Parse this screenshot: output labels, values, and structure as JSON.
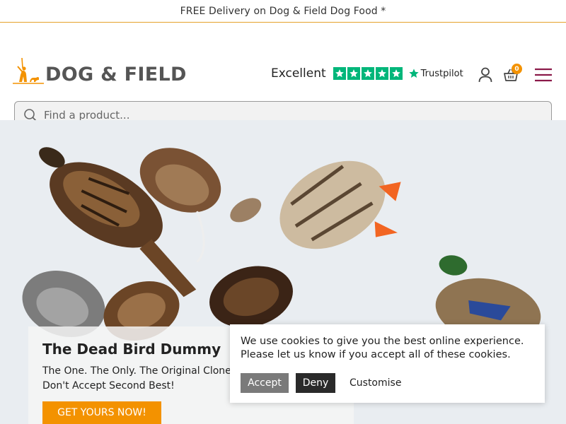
{
  "announcement": "FREE Delivery on Dog & Field Dog Food *",
  "brand": {
    "name": "DOG & FIELD",
    "accent": "#f39200",
    "menu_color": "#8b1a4a"
  },
  "trustpilot": {
    "label": "Excellent",
    "brand_text": "Trustpilot",
    "stars": 5,
    "star_color": "#00b67a"
  },
  "header": {
    "basket_count": "0",
    "icons": [
      "user-icon",
      "basket-icon",
      "hamburger-menu-icon",
      "search-icon"
    ]
  },
  "search": {
    "placeholder": "Find a product..."
  },
  "hero": {
    "title": "The Dead Bird Dummy",
    "line1": "The One. The Only. The Original Clone.",
    "line2": "Don't Accept Second Best!",
    "cta": "GET YOURS NOW!"
  },
  "cookie": {
    "message": "We use cookies to give you the best online experience. Please let us know if you accept all of these cookies.",
    "accept": "Accept",
    "deny": "Deny",
    "customise": "Customise"
  }
}
